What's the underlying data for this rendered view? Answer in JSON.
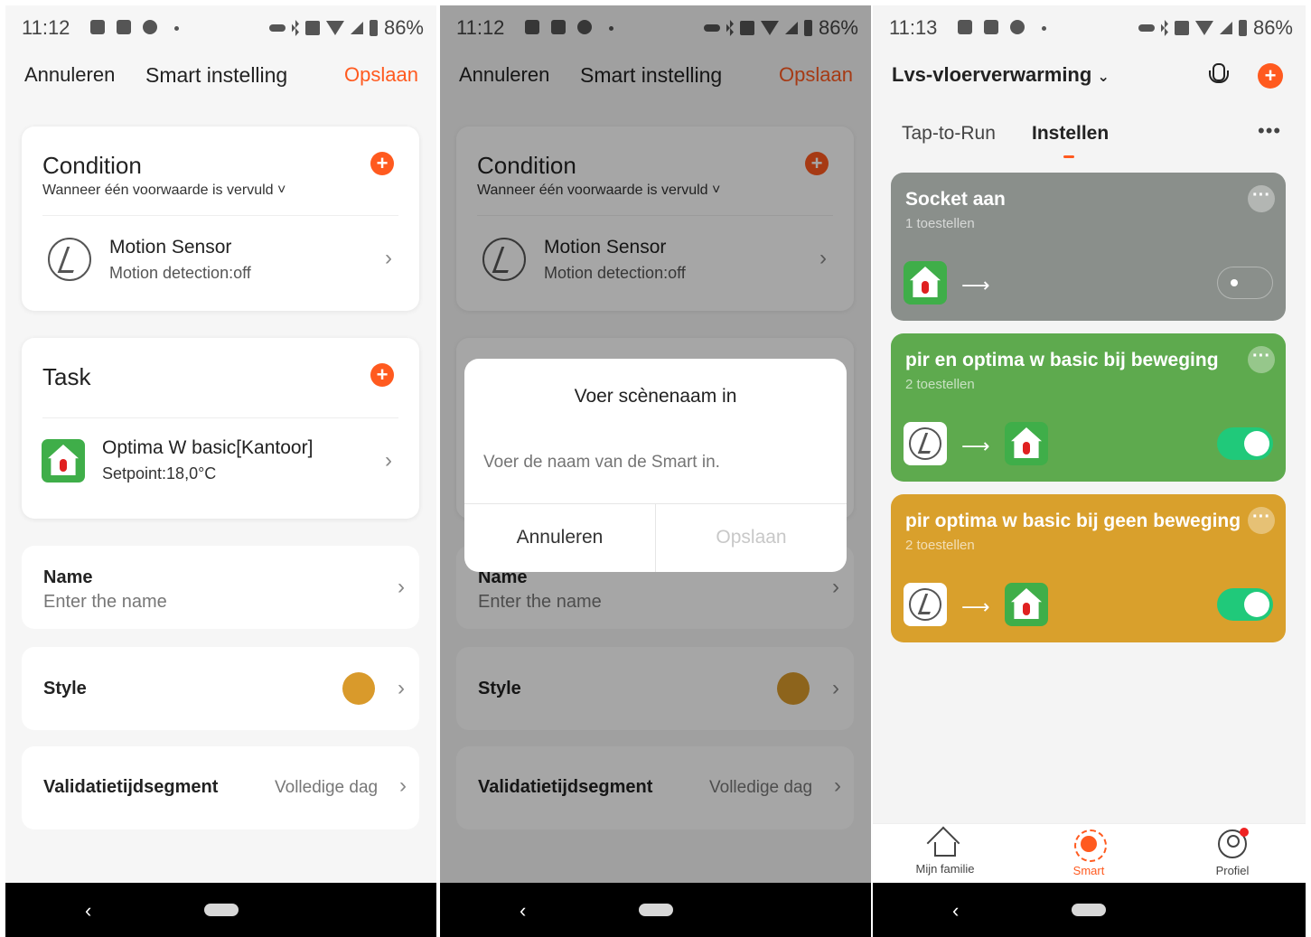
{
  "status": {
    "left": {
      "time": "11:12"
    },
    "right_time": "11:13",
    "battery": "86%"
  },
  "editor": {
    "cancel": "Annuleren",
    "title": "Smart instelling",
    "save": "Opslaan",
    "condition": {
      "title": "Condition",
      "subtitle": "Wanneer één voorwaarde is vervuld",
      "item_title": "Motion Sensor",
      "item_sub": "Motion detection:off"
    },
    "task": {
      "title": "Task",
      "item_title": "Optima W basic[Kantoor]",
      "item_sub": "Setpoint:18,0°C"
    },
    "name": {
      "label": "Name",
      "placeholder": "Enter the name"
    },
    "style": {
      "label": "Style",
      "color": "#d99a2b"
    },
    "validity": {
      "label": "Validatietijdsegment",
      "value": "Volledige dag"
    }
  },
  "dialog": {
    "title": "Voer scènenaam in",
    "placeholder": "Voer de naam van de Smart in.",
    "cancel": "Annuleren",
    "save": "Opslaan"
  },
  "smart": {
    "home": "Lvs-vloerverwarming",
    "tabs": [
      "Tap-to-Run",
      "Instellen"
    ],
    "scenes": [
      {
        "title": "Socket aan",
        "devices": "1 toestellen",
        "enabled": false,
        "color": "#8a8f8b"
      },
      {
        "title": "pir en optima w basic bij beweging",
        "devices": "2 toestellen",
        "enabled": true,
        "color": "#5eaa4e"
      },
      {
        "title": "pir optima w basic bij geen beweging",
        "devices": "2 toestellen",
        "enabled": true,
        "color": "#d9a02c"
      }
    ],
    "tabbar": [
      "Mijn familie",
      "Smart",
      "Profiel"
    ]
  },
  "accent": "#ff5a1f"
}
